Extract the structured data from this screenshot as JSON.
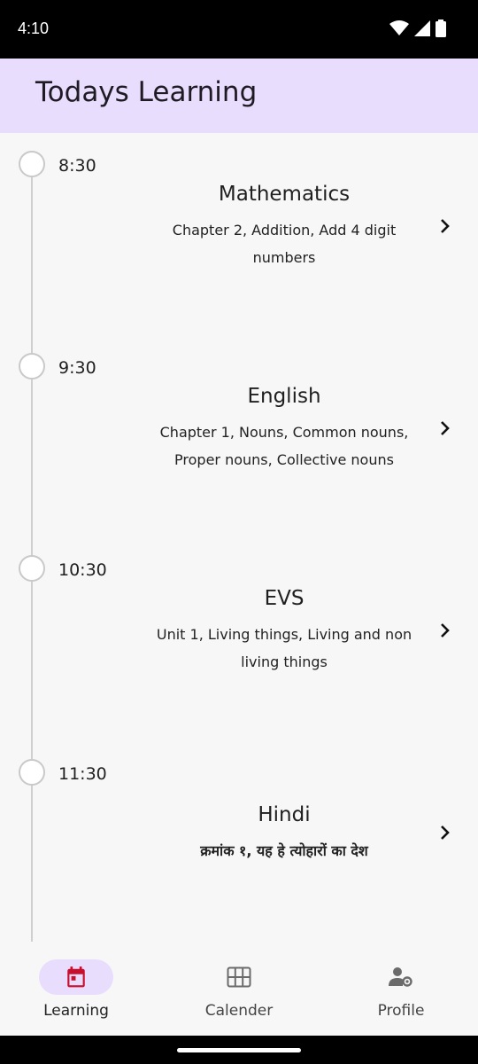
{
  "status_bar": {
    "time": "4:10",
    "icons": [
      "wifi-icon",
      "signal-icon",
      "battery-icon"
    ]
  },
  "app_bar": {
    "title": "Todays Learning"
  },
  "schedule": [
    {
      "time": "8:30",
      "subject": "Mathematics",
      "details": "Chapter 2, Addition, Add 4 digit numbers"
    },
    {
      "time": "9:30",
      "subject": "English",
      "details": "Chapter 1, Nouns, Common nouns, Proper nouns, Collective nouns"
    },
    {
      "time": "10:30",
      "subject": "EVS",
      "details": "Unit 1, Living things, Living and non living things"
    },
    {
      "time": "11:30",
      "subject": "Hindi",
      "details": "क्रमांक १, यह हे त्योहारों का देश"
    }
  ],
  "bottom_nav": {
    "items": [
      {
        "label": "Learning",
        "icon": "calendar-icon",
        "active": true
      },
      {
        "label": "Calender",
        "icon": "grid-icon",
        "active": false
      },
      {
        "label": "Profile",
        "icon": "profile-settings-icon",
        "active": false
      }
    ]
  },
  "colors": {
    "accent_container": "#e9ddfd",
    "active_icon": "#c8102e",
    "inactive_icon": "#6b6b6b",
    "background": "#f7f7f7"
  }
}
